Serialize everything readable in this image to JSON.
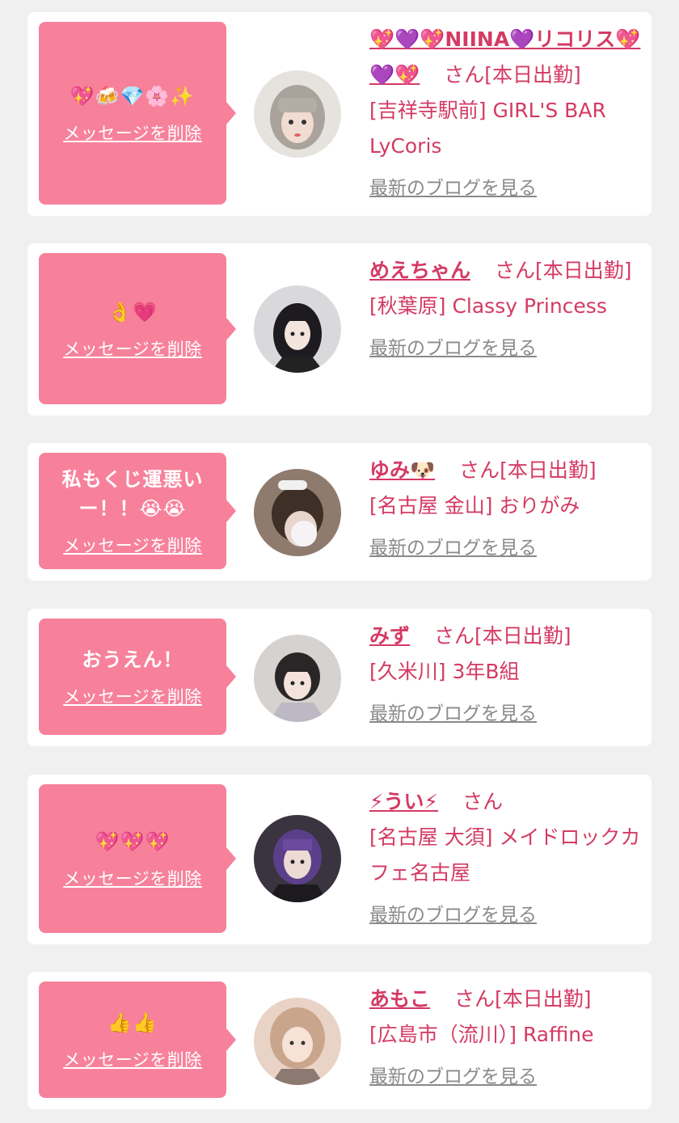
{
  "colors": {
    "accent": "#d43a64",
    "bubble": "#f7819b",
    "card": "#ffffff",
    "background": "#f0f0f0",
    "link_gray": "#8a8a8a"
  },
  "entries": [
    {
      "message": "💖🍻💎🌸✨",
      "delete_label": "メッセージを削除",
      "name": "💖💜💖NIINA💜リコリス💖💜💖",
      "honorific": "さん",
      "status": "[本日出勤]",
      "shop": "[吉祥寺駅前] GIRL'S BAR LyCoris",
      "blog_label": "最新のブログを見る"
    },
    {
      "message": "👌💗",
      "delete_label": "メッセージを削除",
      "name": "めえちゃん",
      "honorific": "さん",
      "status": "[本日出勤]",
      "shop": "[秋葉原] Classy Princess",
      "blog_label": "最新のブログを見る"
    },
    {
      "message": "私もくじ運悪いー！！😭😭",
      "delete_label": "メッセージを削除",
      "name": "ゆみ🐶",
      "honorific": "さん",
      "status": "[本日出勤]",
      "shop": "[名古屋 金山] おりがみ",
      "blog_label": "最新のブログを見る"
    },
    {
      "message": "おうえん！",
      "delete_label": "メッセージを削除",
      "name": "みず",
      "honorific": "さん",
      "status": "[本日出勤]",
      "shop": "[久米川] 3年B組",
      "blog_label": "最新のブログを見る"
    },
    {
      "message": "💖💖💖",
      "delete_label": "メッセージを削除",
      "name": "⚡うい⚡",
      "honorific": "さん",
      "status": "",
      "shop": "[名古屋 大須] メイドロックカフェ名古屋",
      "blog_label": "最新のブログを見る"
    },
    {
      "message": "👍👍",
      "delete_label": "メッセージを削除",
      "name": "あもこ",
      "honorific": "さん",
      "status": "[本日出勤]",
      "shop": "[広島市（流川）] Raffine",
      "blog_label": "最新のブログを見る"
    }
  ]
}
